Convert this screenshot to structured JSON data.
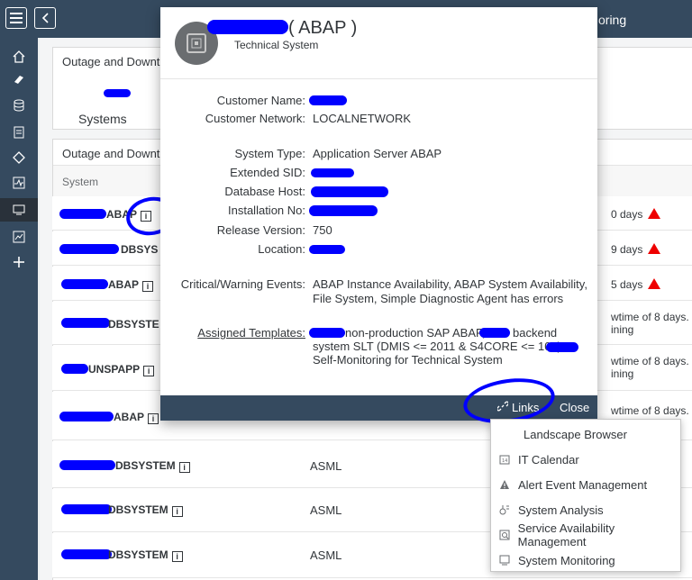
{
  "shell": {
    "title_partial": "oring"
  },
  "background": {
    "card1_title": "Outage and Downt",
    "card1_label": "Systems",
    "card2_title": "Outage and Downt",
    "column_system": "System",
    "rows": [
      {
        "name": "ABAP",
        "type": "",
        "status": "0 days",
        "warn": true
      },
      {
        "name": "DBSYS",
        "type": "",
        "status": "9 days",
        "warn": true
      },
      {
        "name": "ABAP",
        "type": "",
        "status": "5 days",
        "warn": true
      },
      {
        "name": "DBSYSTE",
        "type": "",
        "status": "wtime of 8 days.",
        "status2": "ining"
      },
      {
        "name": "UNSPAPP",
        "type": "",
        "status": "wtime of 8 days.",
        "status2": "ining"
      },
      {
        "name": "ABAP",
        "type": "",
        "status": "wtime of 8 days."
      },
      {
        "name": "DBSYSTEM",
        "type": "ASML",
        "status": ""
      },
      {
        "name": "DBSYSTEM",
        "type": "ASML",
        "status": ""
      },
      {
        "name": "DBSYSTEM",
        "type": "ASML",
        "status": ""
      }
    ]
  },
  "dialog": {
    "title": "( ABAP )",
    "subtitle": "Technical System",
    "fields": {
      "customer_name_label": "Customer Name:",
      "customer_network_label": "Customer Network:",
      "customer_network_value": "LOCALNETWORK",
      "system_type_label": "System Type:",
      "system_type_value": "Application Server ABAP",
      "extended_sid_label": "Extended SID:",
      "database_host_label": "Database Host:",
      "installation_no_label": "Installation No:",
      "release_version_label": "Release Version:",
      "release_version_value": "750",
      "location_label": "Location:",
      "critical_events_label": "Critical/Warning Events:",
      "critical_events_value_line1": "ABAP Instance Availability, ABAP System Availability,",
      "critical_events_value_line2": "File System, Simple Diagnostic Agent has errors",
      "assigned_templates_label": "Assigned Templates:",
      "assigned_templates_line1": "non-production SAP ABAP,",
      "assigned_templates_line1b": "backend",
      "assigned_templates_line2": "system SLT (DMIS <= 2011 & S4CORE <= 102),",
      "assigned_templates_line3": "Self-Monitoring for Technical System"
    },
    "links_label": "Links",
    "close_label": "Close"
  },
  "links_menu": {
    "items": [
      {
        "label": "Landscape Browser",
        "icon": "none"
      },
      {
        "label": "IT Calendar",
        "icon": "calendar-icon"
      },
      {
        "label": "Alert Event Management",
        "icon": "warning-icon"
      },
      {
        "label": "System Analysis",
        "icon": "analysis-icon"
      },
      {
        "label": "Service Availability Management",
        "icon": "service-availability-icon"
      },
      {
        "label": "System Monitoring",
        "icon": "monitor-icon"
      }
    ]
  },
  "colors": {
    "shell": "#354a5f",
    "redaction": "#0000ff",
    "warning": "#e00000"
  }
}
